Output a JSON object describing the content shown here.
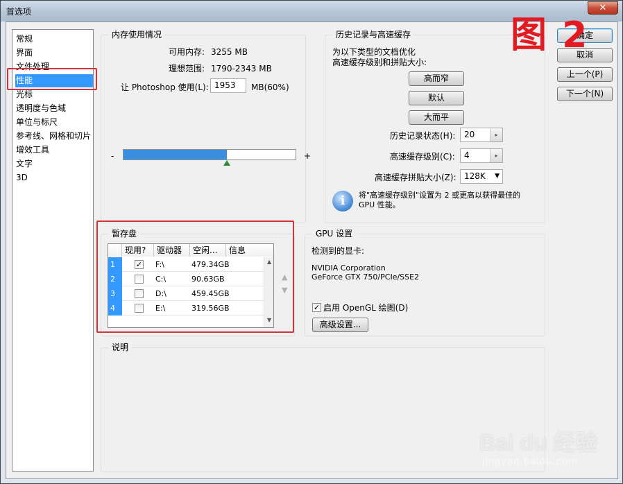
{
  "window": {
    "title": "首选项",
    "close_label": "✕"
  },
  "overlay": {
    "figure_label": "图 2",
    "watermark_brand": "Bai du 经验",
    "watermark_url": "jingyan.baidu.com"
  },
  "nav": {
    "items": [
      "常规",
      "界面",
      "文件处理",
      "性能",
      "光标",
      "透明度与色域",
      "单位与标尺",
      "参考线、网格和切片",
      "增效工具",
      "文字",
      "3D"
    ],
    "selected_index": 3
  },
  "memory": {
    "title": "内存使用情况",
    "available_label": "可用内存:",
    "available_value": "3255 MB",
    "ideal_label": "理想范围:",
    "ideal_value": "1790-2343 MB",
    "use_label": "让 Photoshop 使用(L):",
    "use_value": "1953",
    "use_unit": "MB(60%)",
    "slider_fraction": 0.6,
    "minus": "-",
    "plus": "+"
  },
  "history": {
    "title": "历史记录与高速缓存",
    "desc_line1": "为以下类型的文档优化",
    "desc_line2": "高速缓存级别和拼贴大小:",
    "btn_tall_thin": "高而窄",
    "btn_default": "默认",
    "btn_big_flat": "大而平",
    "history_states_label": "历史记录状态(H):",
    "history_states_value": "20",
    "cache_levels_label": "高速缓存级别(C):",
    "cache_levels_value": "4",
    "tile_size_label": "高速缓存拼贴大小(Z):",
    "tile_size_value": "128K",
    "info_line1": "将\"高速缓存级别\"设置为 2 或更高以获得最佳的",
    "info_line2": "GPU 性能。"
  },
  "scratch": {
    "title": "暂存盘",
    "columns": [
      "现用?",
      "驱动器",
      "空闲...",
      "信息"
    ],
    "rows": [
      {
        "num": "1",
        "active": true,
        "drive": "F:\\",
        "free": "479.34GB",
        "info": ""
      },
      {
        "num": "2",
        "active": false,
        "drive": "C:\\",
        "free": "90.63GB",
        "info": ""
      },
      {
        "num": "3",
        "active": false,
        "drive": "D:\\",
        "free": "459.45GB",
        "info": ""
      },
      {
        "num": "4",
        "active": false,
        "drive": "E:\\",
        "free": "319.56GB",
        "info": ""
      }
    ]
  },
  "gpu": {
    "title": "GPU 设置",
    "detected_label": "检测到的显卡:",
    "card_line1": "NVIDIA Corporation",
    "card_line2": "GeForce GTX 750/PCIe/SSE2",
    "opengl_label": "启用 OpenGL 绘图(D)",
    "opengl_checked": true,
    "advanced_button": "高级设置..."
  },
  "description": {
    "title": "说明",
    "body": ""
  },
  "actions": {
    "ok": "确定",
    "cancel": "取消",
    "prev": "上一个(P)",
    "next": "下一个(N)"
  },
  "colors": {
    "accent": "#3399ff",
    "highlight_red": "#d2343a"
  }
}
